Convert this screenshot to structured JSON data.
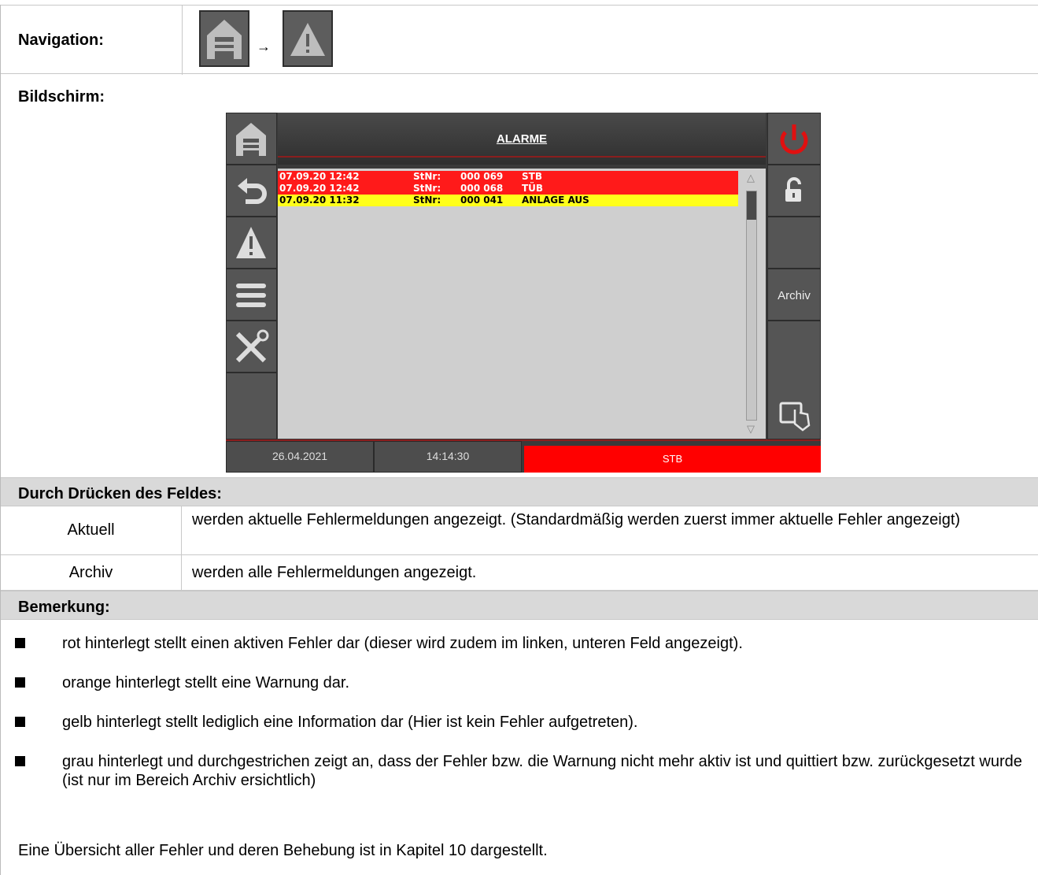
{
  "navigation": {
    "label": "Navigation:",
    "arrow": "→",
    "home_icon": "home-icon",
    "alarm_icon": "warning-icon"
  },
  "screen_section": {
    "label": "Bildschirm:"
  },
  "device": {
    "title": "ALARME",
    "alarms": [
      {
        "date": "07.09.20 12:42",
        "stnr": "StNr:",
        "num": "000  069",
        "msg": "STB",
        "color": "#ff1a1a",
        "text_color": "#ffffff"
      },
      {
        "date": "07.09.20 12:42",
        "stnr": "StNr:",
        "num": "000  068",
        "msg": "TÜB",
        "color": "#ff1a1a",
        "text_color": "#ffffff"
      },
      {
        "date": "07.09.20 11:32",
        "stnr": "StNr:",
        "num": "000  041",
        "msg": "ANLAGE AUS",
        "color": "#ffff1a",
        "text_color": "#000000"
      }
    ],
    "right_buttons": {
      "archiv": "Archiv"
    },
    "footer": {
      "date": "26.04.2021",
      "time": "14:14:30",
      "status": "STB"
    }
  },
  "press": {
    "heading": "Durch Drücken des Feldes:",
    "rows": [
      {
        "field": "Aktuell",
        "text": "werden aktuelle Fehlermeldungen angezeigt. (Standardmäßig werden zuerst immer aktuelle Fehler angezeigt)"
      },
      {
        "field": "Archiv",
        "text": "werden alle Fehlermeldungen angezeigt."
      }
    ]
  },
  "remark": {
    "heading": "Bemerkung:",
    "bullets": [
      "rot hinterlegt stellt einen aktiven Fehler dar (dieser wird zudem im linken, unteren Feld angezeigt).",
      "orange hinterlegt stellt eine Warnung dar.",
      "gelb hinterlegt stellt lediglich eine Information dar (Hier ist kein Fehler aufgetreten).",
      "grau hinterlegt und durchgestrichen zeigt an, dass der Fehler bzw. die Warnung nicht mehr aktiv ist und quittiert bzw. zurückgesetzt wurde (ist nur im Bereich Archiv ersichtlich)"
    ],
    "footnote": "Eine Übersicht aller Fehler und deren Behebung ist in Kapitel 10 dargestellt."
  }
}
